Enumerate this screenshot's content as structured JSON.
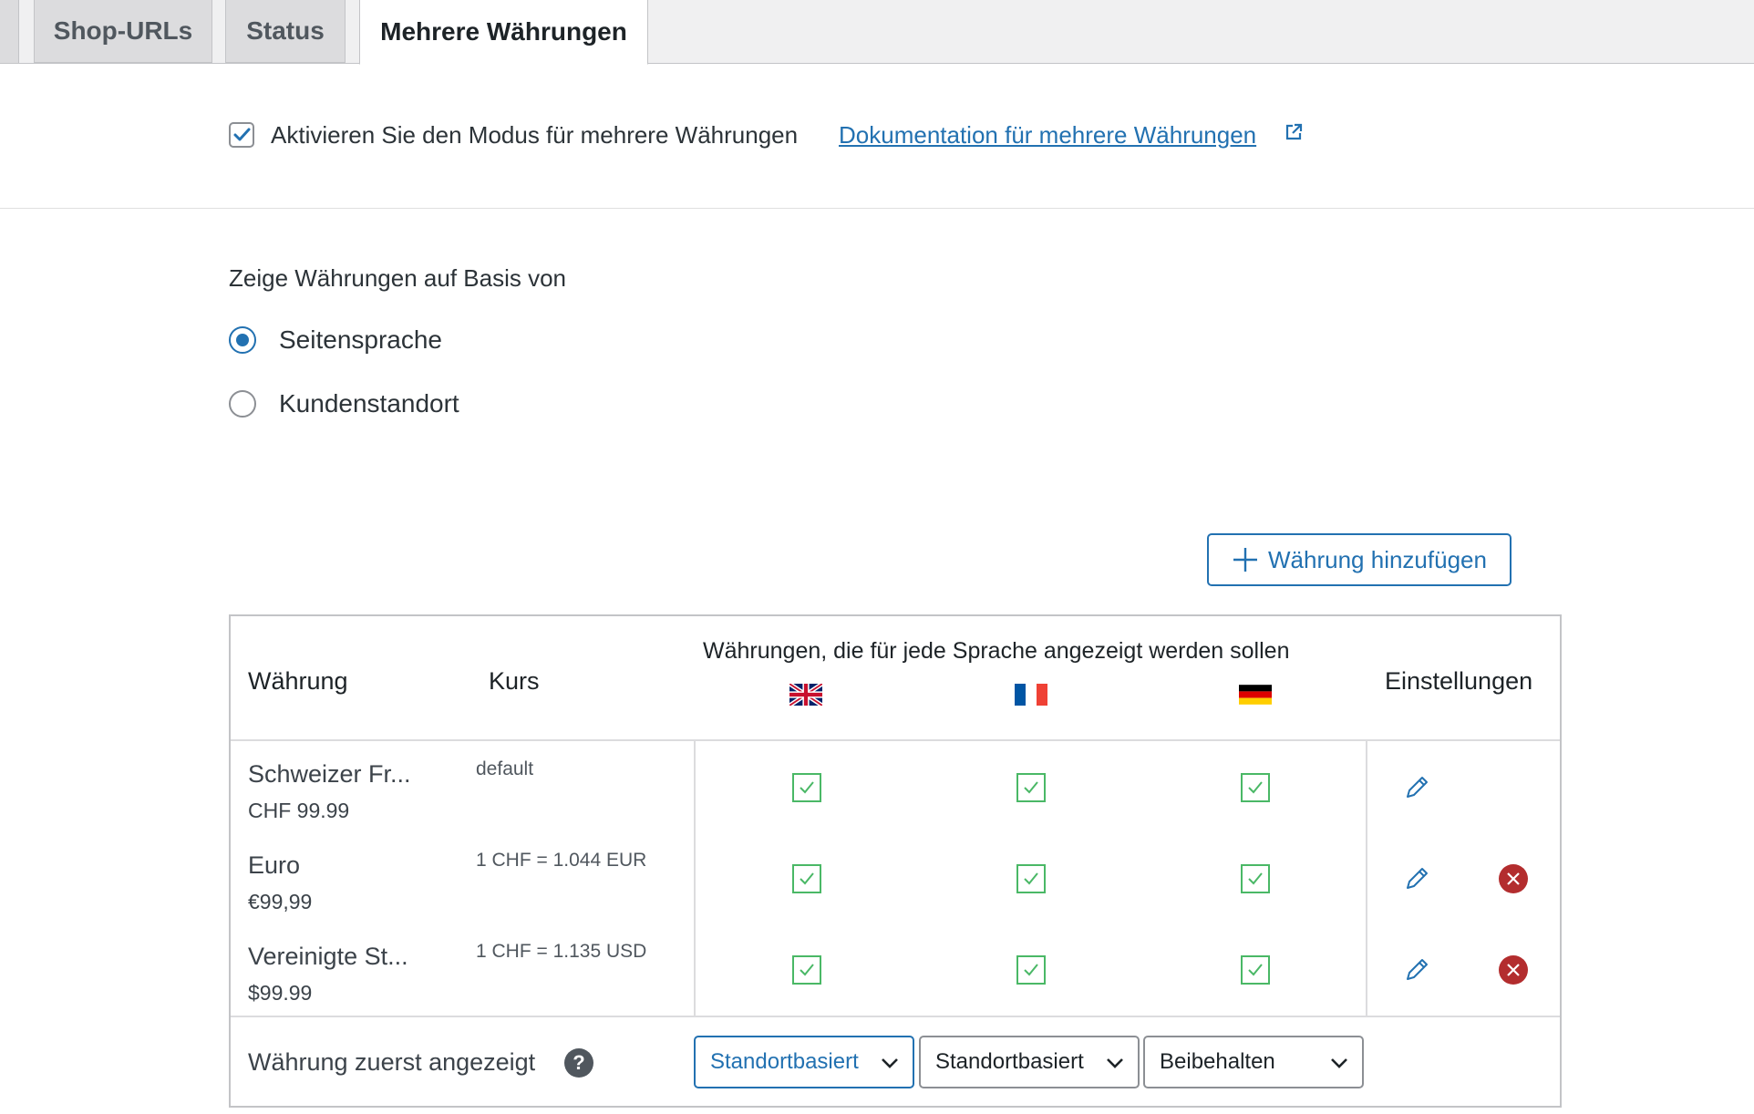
{
  "tabs": [
    {
      "label": "Shop-URLs",
      "active": false
    },
    {
      "label": "Status",
      "active": false
    },
    {
      "label": "Mehrere Währungen",
      "active": true
    }
  ],
  "multi_currency": {
    "enabled": true,
    "enable_label": "Aktivieren Sie den Modus für mehrere Währungen",
    "docs_link": "Dokumentation für mehrere Währungen"
  },
  "display_basis": {
    "title": "Zeige Währungen auf Basis von",
    "options": [
      {
        "label": "Seitensprache",
        "selected": true
      },
      {
        "label": "Kundenstandort",
        "selected": false
      }
    ]
  },
  "add_currency_label": "Währung hinzufügen",
  "table": {
    "col_currency": "Währung",
    "col_rate": "Kurs",
    "col_languages": "Währungen, die für jede Sprache angezeigt werden sollen",
    "col_settings": "Einstellungen",
    "languages": [
      "english-uk-flag",
      "french-flag",
      "german-flag"
    ],
    "rows": [
      {
        "name": "Schweizer Fr...",
        "price": "CHF 99.99",
        "rate": "default",
        "checks": [
          true,
          true,
          true
        ],
        "deletable": false
      },
      {
        "name": "Euro",
        "price": "€99,99",
        "rate": "1 CHF = 1.044 EUR",
        "checks": [
          true,
          true,
          true
        ],
        "deletable": true
      },
      {
        "name": "Vereinigte St...",
        "price": "$99.99",
        "rate": "1 CHF = 1.135 USD",
        "checks": [
          true,
          true,
          true
        ],
        "deletable": true
      }
    ],
    "footer": {
      "label": "Währung zuerst angezeigt",
      "help": "?",
      "selects": [
        "Standortbasiert",
        "Standortbasiert",
        "Beibehalten"
      ]
    }
  },
  "colors": {
    "accent": "#2271b1",
    "check_green": "#4ab866",
    "delete_red": "#b32d2e"
  }
}
